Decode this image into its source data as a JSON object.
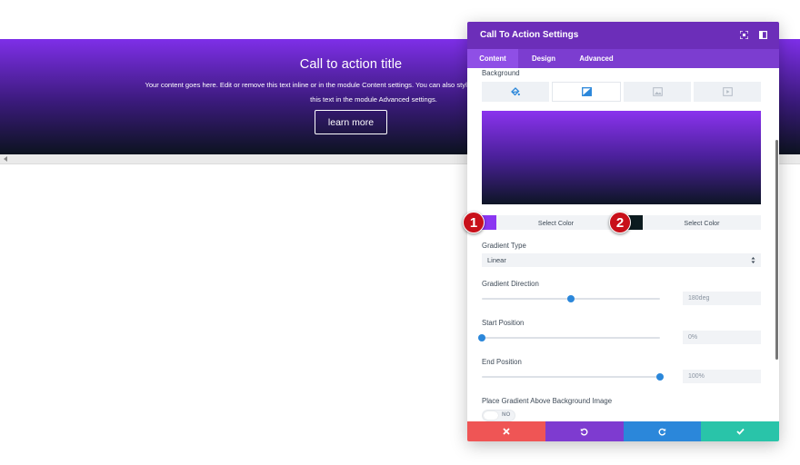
{
  "cta": {
    "title": "Call to action title",
    "body_line1": "Your content goes here. Edit or remove this text inline or in the module Content settings. You can also style every aspect of this content",
    "body_line2": "this text in the module Advanced settings.",
    "button_label": "learn more"
  },
  "modal": {
    "title": "Call To Action Settings",
    "tabs": [
      {
        "label": "Content",
        "active": true
      },
      {
        "label": "Design",
        "active": false
      },
      {
        "label": "Advanced",
        "active": false
      }
    ],
    "background_label": "Background",
    "background_tab_icons": [
      "paint-bucket-icon",
      "gradient-icon",
      "image-icon",
      "video-icon"
    ],
    "gradient": {
      "color1": "#8b36f1",
      "color2": "#0c1b1f",
      "select_color_label_1": "Select Color",
      "select_color_label_2": "Select Color",
      "type_label": "Gradient Type",
      "type_value": "Linear",
      "direction_label": "Gradient Direction",
      "direction_value": "180deg",
      "direction_fraction": 0.5,
      "start_label": "Start Position",
      "start_value": "0%",
      "start_fraction": 0.0,
      "end_label": "End Position",
      "end_value": "100%",
      "end_fraction": 1.0,
      "place_above_label": "Place Gradient Above Background Image",
      "place_above_value": "NO"
    },
    "footer": {
      "cancel_color": "#ef5555",
      "undo_color": "#7e3bd0",
      "redo_color": "#2b87da",
      "save_color": "#29c4a9"
    }
  },
  "markers": [
    "1",
    "2"
  ],
  "colors": {
    "accent": "#2b87da",
    "header": "#6c2eb9",
    "tabs": "#7c3dd0",
    "marker": "#c8101a"
  }
}
